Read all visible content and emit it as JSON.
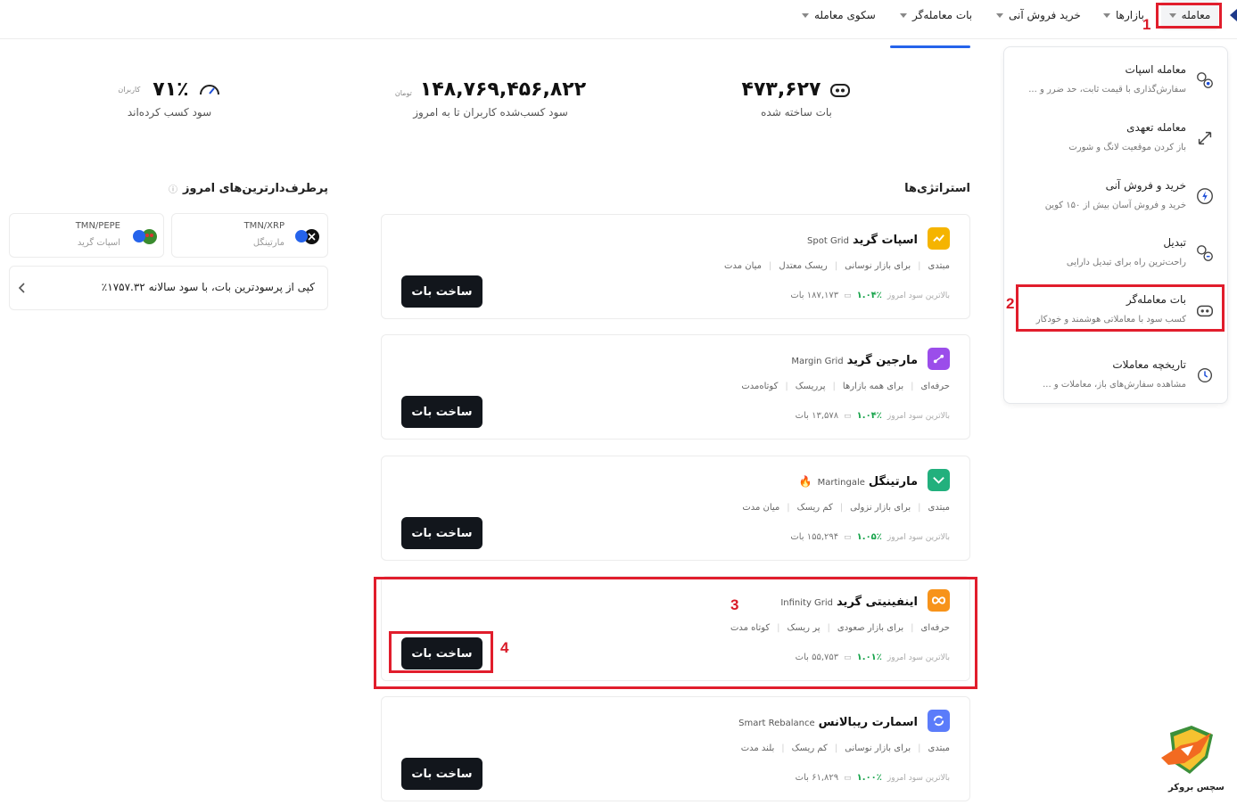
{
  "nav": {
    "items": [
      "معامله",
      "بازارها",
      "خرید فروش آنی",
      "بات معامله‌گر",
      "سکوی معامله"
    ]
  },
  "menu": [
    {
      "title": "معامله اسپات",
      "desc": "سفارش‌گذاری با قیمت ثابت، حد ضرر و ...",
      "icon": "spot-trade-icon"
    },
    {
      "title": "معامله تعهدی",
      "desc": "باز کردن موقعیت لانگ و شورت",
      "icon": "margin-arrows-icon"
    },
    {
      "title": "خرید و فروش آنی",
      "desc": "خرید و فروش آسان بیش از ۱۵۰ کوین",
      "icon": "lightning-icon"
    },
    {
      "title": "تبدیل",
      "desc": "راحت‌ترین راه برای تبدیل دارایی",
      "icon": "convert-icon"
    },
    {
      "title": "بات معامله‌گر",
      "desc": "کسب سود با معاملاتی هوشمند و خودکار",
      "icon": "robot-icon"
    },
    {
      "title": "تاریخچه معاملات",
      "desc": "مشاهده سفارش‌های باز، معاملات و ...",
      "icon": "history-icon"
    }
  ],
  "stats": {
    "bots": {
      "value": "۴۷۳,۶۲۷",
      "label": "بات ساخته شده"
    },
    "profit": {
      "value": "۱۴۸,۷۶۹,۴۵۶,۸۲۲",
      "unit": "تومان",
      "label": "سود کسب‌شده کاربران تا به امروز"
    },
    "users": {
      "value": "۷۱٪",
      "unit": "کاربران",
      "label": "سود کسب کرده‌اند"
    }
  },
  "strategies": {
    "title": "استراتژی‌ها",
    "stat_prefix": "بالاترین سود امروز",
    "button_label": "ساخت بات",
    "items": [
      {
        "name": "اسپات گرید",
        "en": "Spot Grid",
        "tags": [
          "مبتدی",
          "برای بازار نوسانی",
          "ریسک معتدل",
          "میان مدت"
        ],
        "pct": "۱.۰۴٪",
        "bots": "۱۸۷,۱۷۳ بات",
        "color": "#f5b400"
      },
      {
        "name": "مارجین گرید",
        "en": "Margin Grid",
        "tags": [
          "حرفه‌ای",
          "برای همه بازارها",
          "پرریسک",
          "کوتاه‌مدت"
        ],
        "pct": "۱.۰۴٪",
        "bots": "۱۳,۵۷۸ بات",
        "color": "#9b4dea"
      },
      {
        "name": "مارتینگل",
        "en": "Martingale",
        "tags": [
          "مبتدی",
          "برای بازار نزولی",
          "کم ریسک",
          "میان مدت"
        ],
        "pct": "۱.۰۵٪",
        "bots": "۱۵۵,۲۹۴ بات",
        "color": "#22b07d"
      },
      {
        "name": "اینفینیتی گرید",
        "en": "Infinity Grid",
        "tags": [
          "حرفه‌ای",
          "برای بازار صعودی",
          "پر ریسک",
          "کوتاه مدت"
        ],
        "pct": "۱.۰۱٪",
        "bots": "۵۵,۷۵۳ بات",
        "color": "#f7931a"
      },
      {
        "name": "اسمارت ریبالانس",
        "en": "Smart Rebalance",
        "tags": [
          "مبتدی",
          "برای بازار نوسانی",
          "کم ریسک",
          "بلند مدت"
        ],
        "pct": "۱.۰۰٪",
        "bots": "۶۱,۸۲۹ بات",
        "color": "#5b7cfa"
      }
    ]
  },
  "performers": {
    "title": "پرطرف‌دارترین‌های امروز",
    "cards": [
      {
        "pair": "TMN/XRP",
        "type": "مارتینگل"
      },
      {
        "pair": "TMN/PEPE",
        "type": "اسپات گرید"
      }
    ],
    "copy_text": "کپی از پرسودترین بات، با سود سالانه ۱۷۵۷.۳۲٪"
  },
  "annotations": [
    "1",
    "2",
    "3",
    "4"
  ],
  "logo_text": "سچس بروکر"
}
